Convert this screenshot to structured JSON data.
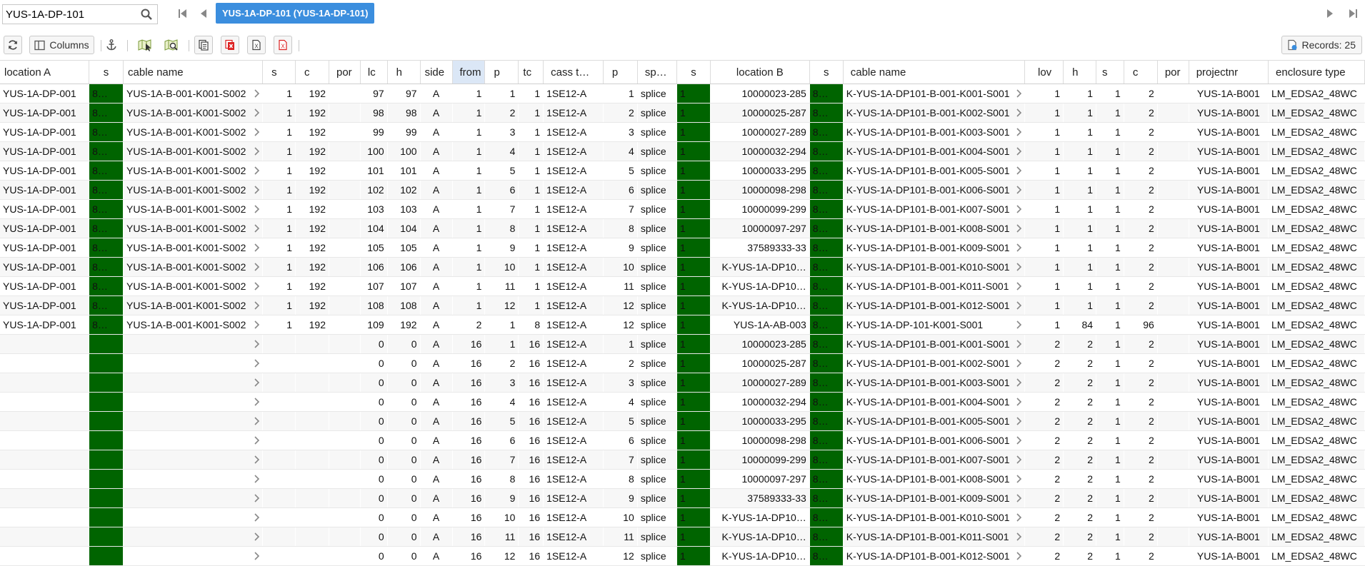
{
  "search": {
    "value": "YUS-1A-DP-101"
  },
  "active_record_tab": "YUS-1A-DP-101 (YUS-1A-DP-101)",
  "toolbar": {
    "columns_label": "Columns",
    "records_label": "Records: 25"
  },
  "colors": {
    "tab_blue": "#3b8ede",
    "status_green": "#006400",
    "header_active": "#dbe7f6"
  },
  "columns": [
    "location A",
    "s",
    "cable name",
    "s",
    "c",
    "por",
    "lc",
    "h",
    "side",
    "from",
    "p",
    "tc",
    "cass t…",
    "p",
    "sp…",
    "s",
    "location B",
    "s",
    "cable name",
    "lov",
    "h",
    "s",
    "c",
    "por",
    "projectnr",
    "enclosure type"
  ],
  "rows": [
    [
      "YUS-1A-DP-001",
      "8…",
      "YUS-1A-B-001-K001-S002",
      "1",
      "192",
      "",
      "97",
      "97",
      "A",
      "1",
      "1",
      "1",
      "1SE12-A",
      "1",
      "splice",
      "1",
      "10000023-285",
      "8…",
      "K-YUS-1A-DP101-B-001-K001-S001",
      "1",
      "1",
      "1",
      "2",
      "",
      "YUS-1A-B001",
      "LM_EDSA2_48WC"
    ],
    [
      "YUS-1A-DP-001",
      "8…",
      "YUS-1A-B-001-K001-S002",
      "1",
      "192",
      "",
      "98",
      "98",
      "A",
      "1",
      "2",
      "1",
      "1SE12-A",
      "2",
      "splice",
      "1",
      "10000025-287",
      "8…",
      "K-YUS-1A-DP101-B-001-K002-S001",
      "1",
      "1",
      "1",
      "2",
      "",
      "YUS-1A-B001",
      "LM_EDSA2_48WC"
    ],
    [
      "YUS-1A-DP-001",
      "8…",
      "YUS-1A-B-001-K001-S002",
      "1",
      "192",
      "",
      "99",
      "99",
      "A",
      "1",
      "3",
      "1",
      "1SE12-A",
      "3",
      "splice",
      "1",
      "10000027-289",
      "8…",
      "K-YUS-1A-DP101-B-001-K003-S001",
      "1",
      "1",
      "1",
      "2",
      "",
      "YUS-1A-B001",
      "LM_EDSA2_48WC"
    ],
    [
      "YUS-1A-DP-001",
      "8…",
      "YUS-1A-B-001-K001-S002",
      "1",
      "192",
      "",
      "100",
      "100",
      "A",
      "1",
      "4",
      "1",
      "1SE12-A",
      "4",
      "splice",
      "1",
      "10000032-294",
      "8…",
      "K-YUS-1A-DP101-B-001-K004-S001",
      "1",
      "1",
      "1",
      "2",
      "",
      "YUS-1A-B001",
      "LM_EDSA2_48WC"
    ],
    [
      "YUS-1A-DP-001",
      "8…",
      "YUS-1A-B-001-K001-S002",
      "1",
      "192",
      "",
      "101",
      "101",
      "A",
      "1",
      "5",
      "1",
      "1SE12-A",
      "5",
      "splice",
      "1",
      "10000033-295",
      "8…",
      "K-YUS-1A-DP101-B-001-K005-S001",
      "1",
      "1",
      "1",
      "2",
      "",
      "YUS-1A-B001",
      "LM_EDSA2_48WC"
    ],
    [
      "YUS-1A-DP-001",
      "8…",
      "YUS-1A-B-001-K001-S002",
      "1",
      "192",
      "",
      "102",
      "102",
      "A",
      "1",
      "6",
      "1",
      "1SE12-A",
      "6",
      "splice",
      "1",
      "10000098-298",
      "8…",
      "K-YUS-1A-DP101-B-001-K006-S001",
      "1",
      "1",
      "1",
      "2",
      "",
      "YUS-1A-B001",
      "LM_EDSA2_48WC"
    ],
    [
      "YUS-1A-DP-001",
      "8…",
      "YUS-1A-B-001-K001-S002",
      "1",
      "192",
      "",
      "103",
      "103",
      "A",
      "1",
      "7",
      "1",
      "1SE12-A",
      "7",
      "splice",
      "1",
      "10000099-299",
      "8…",
      "K-YUS-1A-DP101-B-001-K007-S001",
      "1",
      "1",
      "1",
      "2",
      "",
      "YUS-1A-B001",
      "LM_EDSA2_48WC"
    ],
    [
      "YUS-1A-DP-001",
      "8…",
      "YUS-1A-B-001-K001-S002",
      "1",
      "192",
      "",
      "104",
      "104",
      "A",
      "1",
      "8",
      "1",
      "1SE12-A",
      "8",
      "splice",
      "1",
      "10000097-297",
      "8…",
      "K-YUS-1A-DP101-B-001-K008-S001",
      "1",
      "1",
      "1",
      "2",
      "",
      "YUS-1A-B001",
      "LM_EDSA2_48WC"
    ],
    [
      "YUS-1A-DP-001",
      "8…",
      "YUS-1A-B-001-K001-S002",
      "1",
      "192",
      "",
      "105",
      "105",
      "A",
      "1",
      "9",
      "1",
      "1SE12-A",
      "9",
      "splice",
      "1",
      "37589333-33",
      "8…",
      "K-YUS-1A-DP101-B-001-K009-S001",
      "1",
      "1",
      "1",
      "2",
      "",
      "YUS-1A-B001",
      "LM_EDSA2_48WC"
    ],
    [
      "YUS-1A-DP-001",
      "8…",
      "YUS-1A-B-001-K001-S002",
      "1",
      "192",
      "",
      "106",
      "106",
      "A",
      "1",
      "10",
      "1",
      "1SE12-A",
      "10",
      "splice",
      "1",
      "K-YUS-1A-DP10…",
      "8…",
      "K-YUS-1A-DP101-B-001-K010-S001",
      "1",
      "1",
      "1",
      "2",
      "",
      "YUS-1A-B001",
      "LM_EDSA2_48WC"
    ],
    [
      "YUS-1A-DP-001",
      "8…",
      "YUS-1A-B-001-K001-S002",
      "1",
      "192",
      "",
      "107",
      "107",
      "A",
      "1",
      "11",
      "1",
      "1SE12-A",
      "11",
      "splice",
      "1",
      "K-YUS-1A-DP10…",
      "8…",
      "K-YUS-1A-DP101-B-001-K011-S001",
      "1",
      "1",
      "1",
      "2",
      "",
      "YUS-1A-B001",
      "LM_EDSA2_48WC"
    ],
    [
      "YUS-1A-DP-001",
      "8…",
      "YUS-1A-B-001-K001-S002",
      "1",
      "192",
      "",
      "108",
      "108",
      "A",
      "1",
      "12",
      "1",
      "1SE12-A",
      "12",
      "splice",
      "1",
      "K-YUS-1A-DP10…",
      "8…",
      "K-YUS-1A-DP101-B-001-K012-S001",
      "1",
      "1",
      "1",
      "2",
      "",
      "YUS-1A-B001",
      "LM_EDSA2_48WC"
    ],
    [
      "YUS-1A-DP-001",
      "8…",
      "YUS-1A-B-001-K001-S002",
      "1",
      "192",
      "",
      "109",
      "192",
      "A",
      "2",
      "1",
      "8",
      "1SE12-A",
      "12",
      "splice",
      "1",
      "YUS-1A-AB-003",
      "8…",
      "K-YUS-1A-DP-101-K001-S001",
      "1",
      "84",
      "1",
      "96",
      "",
      "YUS-1A-B001",
      "LM_EDSA2_48WC"
    ],
    [
      "",
      "",
      "",
      "",
      "",
      "",
      "0",
      "0",
      "A",
      "16",
      "1",
      "16",
      "1SE12-A",
      "1",
      "splice",
      "1",
      "10000023-285",
      "8…",
      "K-YUS-1A-DP101-B-001-K001-S001",
      "2",
      "2",
      "1",
      "2",
      "",
      "YUS-1A-B001",
      "LM_EDSA2_48WC"
    ],
    [
      "",
      "",
      "",
      "",
      "",
      "",
      "0",
      "0",
      "A",
      "16",
      "2",
      "16",
      "1SE12-A",
      "2",
      "splice",
      "1",
      "10000025-287",
      "8…",
      "K-YUS-1A-DP101-B-001-K002-S001",
      "2",
      "2",
      "1",
      "2",
      "",
      "YUS-1A-B001",
      "LM_EDSA2_48WC"
    ],
    [
      "",
      "",
      "",
      "",
      "",
      "",
      "0",
      "0",
      "A",
      "16",
      "3",
      "16",
      "1SE12-A",
      "3",
      "splice",
      "1",
      "10000027-289",
      "8…",
      "K-YUS-1A-DP101-B-001-K003-S001",
      "2",
      "2",
      "1",
      "2",
      "",
      "YUS-1A-B001",
      "LM_EDSA2_48WC"
    ],
    [
      "",
      "",
      "",
      "",
      "",
      "",
      "0",
      "0",
      "A",
      "16",
      "4",
      "16",
      "1SE12-A",
      "4",
      "splice",
      "1",
      "10000032-294",
      "8…",
      "K-YUS-1A-DP101-B-001-K004-S001",
      "2",
      "2",
      "1",
      "2",
      "",
      "YUS-1A-B001",
      "LM_EDSA2_48WC"
    ],
    [
      "",
      "",
      "",
      "",
      "",
      "",
      "0",
      "0",
      "A",
      "16",
      "5",
      "16",
      "1SE12-A",
      "5",
      "splice",
      "1",
      "10000033-295",
      "8…",
      "K-YUS-1A-DP101-B-001-K005-S001",
      "2",
      "2",
      "1",
      "2",
      "",
      "YUS-1A-B001",
      "LM_EDSA2_48WC"
    ],
    [
      "",
      "",
      "",
      "",
      "",
      "",
      "0",
      "0",
      "A",
      "16",
      "6",
      "16",
      "1SE12-A",
      "6",
      "splice",
      "1",
      "10000098-298",
      "8…",
      "K-YUS-1A-DP101-B-001-K006-S001",
      "2",
      "2",
      "1",
      "2",
      "",
      "YUS-1A-B001",
      "LM_EDSA2_48WC"
    ],
    [
      "",
      "",
      "",
      "",
      "",
      "",
      "0",
      "0",
      "A",
      "16",
      "7",
      "16",
      "1SE12-A",
      "7",
      "splice",
      "1",
      "10000099-299",
      "8…",
      "K-YUS-1A-DP101-B-001-K007-S001",
      "2",
      "2",
      "1",
      "2",
      "",
      "YUS-1A-B001",
      "LM_EDSA2_48WC"
    ],
    [
      "",
      "",
      "",
      "",
      "",
      "",
      "0",
      "0",
      "A",
      "16",
      "8",
      "16",
      "1SE12-A",
      "8",
      "splice",
      "1",
      "10000097-297",
      "8…",
      "K-YUS-1A-DP101-B-001-K008-S001",
      "2",
      "2",
      "1",
      "2",
      "",
      "YUS-1A-B001",
      "LM_EDSA2_48WC"
    ],
    [
      "",
      "",
      "",
      "",
      "",
      "",
      "0",
      "0",
      "A",
      "16",
      "9",
      "16",
      "1SE12-A",
      "9",
      "splice",
      "1",
      "37589333-33",
      "8…",
      "K-YUS-1A-DP101-B-001-K009-S001",
      "2",
      "2",
      "1",
      "2",
      "",
      "YUS-1A-B001",
      "LM_EDSA2_48WC"
    ],
    [
      "",
      "",
      "",
      "",
      "",
      "",
      "0",
      "0",
      "A",
      "16",
      "10",
      "16",
      "1SE12-A",
      "10",
      "splice",
      "1",
      "K-YUS-1A-DP10…",
      "8…",
      "K-YUS-1A-DP101-B-001-K010-S001",
      "2",
      "2",
      "1",
      "2",
      "",
      "YUS-1A-B001",
      "LM_EDSA2_48WC"
    ],
    [
      "",
      "",
      "",
      "",
      "",
      "",
      "0",
      "0",
      "A",
      "16",
      "11",
      "16",
      "1SE12-A",
      "11",
      "splice",
      "1",
      "K-YUS-1A-DP10…",
      "8…",
      "K-YUS-1A-DP101-B-001-K011-S001",
      "2",
      "2",
      "1",
      "2",
      "",
      "YUS-1A-B001",
      "LM_EDSA2_48WC"
    ],
    [
      "",
      "",
      "",
      "",
      "",
      "",
      "0",
      "0",
      "A",
      "16",
      "12",
      "16",
      "1SE12-A",
      "12",
      "splice",
      "1",
      "K-YUS-1A-DP10…",
      "8…",
      "K-YUS-1A-DP101-B-001-K012-S001",
      "2",
      "2",
      "1",
      "2",
      "",
      "YUS-1A-B001",
      "LM_EDSA2_48WC"
    ]
  ]
}
